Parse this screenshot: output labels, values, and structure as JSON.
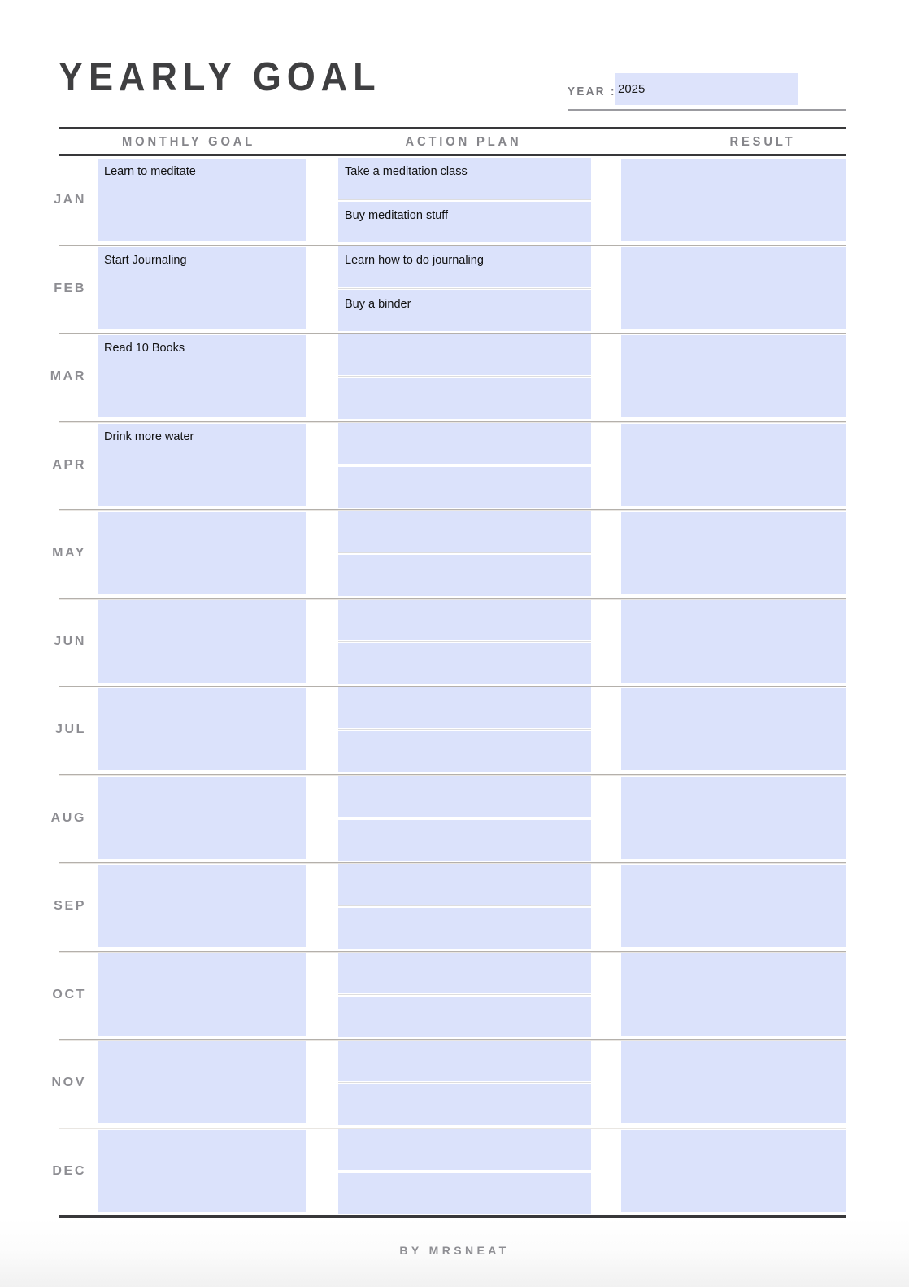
{
  "header": {
    "title": "YEARLY GOAL",
    "year_label": "YEAR :",
    "year_value": "2025",
    "year_placeholder": ""
  },
  "columns": {
    "monthly_goal": "MONTHLY GOAL",
    "action_plan": "ACTION PLAN",
    "result": "RESULT"
  },
  "colors": {
    "field_fill": "#dbe2fb",
    "rule_dark": "#38383a",
    "heading_gray": "#85858a",
    "title_dark": "#3f3f41"
  },
  "rows": [
    {
      "month": "JAN",
      "goal": "Learn to meditate",
      "actions": [
        "Take a meditation class",
        "Buy meditation stuff"
      ],
      "result": ""
    },
    {
      "month": "FEB",
      "goal": "Start Journaling",
      "actions": [
        "Learn how to do journaling",
        "Buy a binder"
      ],
      "result": ""
    },
    {
      "month": "MAR",
      "goal": "Read 10 Books",
      "actions": [
        "",
        ""
      ],
      "result": ""
    },
    {
      "month": "APR",
      "goal": "Drink more water",
      "actions": [
        "",
        ""
      ],
      "result": ""
    },
    {
      "month": "MAY",
      "goal": "",
      "actions": [
        "",
        ""
      ],
      "result": ""
    },
    {
      "month": "JUN",
      "goal": "",
      "actions": [
        "",
        ""
      ],
      "result": ""
    },
    {
      "month": "JUL",
      "goal": "",
      "actions": [
        "",
        ""
      ],
      "result": ""
    },
    {
      "month": "AUG",
      "goal": "",
      "actions": [
        "",
        ""
      ],
      "result": ""
    },
    {
      "month": "SEP",
      "goal": "",
      "actions": [
        "",
        ""
      ],
      "result": ""
    },
    {
      "month": "OCT",
      "goal": "",
      "actions": [
        "",
        ""
      ],
      "result": ""
    },
    {
      "month": "NOV",
      "goal": "",
      "actions": [
        "",
        ""
      ],
      "result": ""
    },
    {
      "month": "DEC",
      "goal": "",
      "actions": [
        "",
        ""
      ],
      "result": ""
    }
  ],
  "footer": {
    "credit": "BY MRSNEAT"
  }
}
